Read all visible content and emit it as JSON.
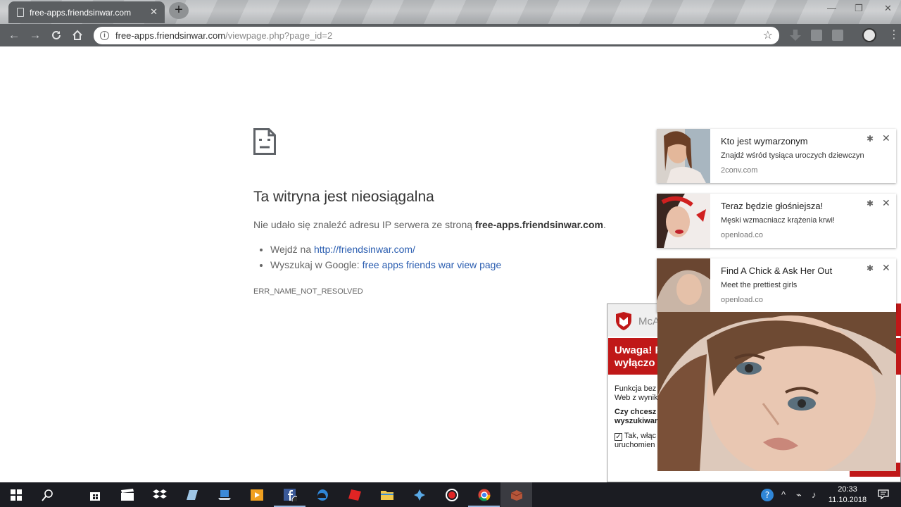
{
  "browser": {
    "tab_title": "free-apps.friendsinwar.com",
    "tab_close": "✕",
    "new_tab": "+",
    "url_host": "free-apps.friendsinwar.com",
    "url_path": "/viewpage.php?page_id=2",
    "win_min": "—",
    "win_max": "❐",
    "win_close": "✕"
  },
  "error_page": {
    "title": "Ta witryna jest nieosiągalna",
    "desc_prefix": "Nie udało się znaleźć adresu IP serwera ze stroną ",
    "desc_host": "free-apps.friendsinwar.com",
    "desc_suffix": ".",
    "suggestion1_prefix": "Wejdź na ",
    "suggestion1_link": "http://friendsinwar.com/",
    "suggestion2_prefix": "Wyszukaj w Google: ",
    "suggestion2_link": "free apps friends war view page",
    "code": "ERR_NAME_NOT_RESOLVED"
  },
  "notifications": [
    {
      "title": "Kto jest wymarzonym",
      "body": "Znajdź wśród tysiąca uroczych dziewczyn",
      "source": "2conv.com"
    },
    {
      "title": "Teraz będzie głośniejsza!",
      "body": "Męski wzmacniacz krążenia krwi!",
      "source": "openload.co"
    },
    {
      "title": "Find A Chick & Ask Her Out",
      "body": "Meet the prettiest girls",
      "source": "openload.co"
    }
  ],
  "mcafee": {
    "brand": "McA",
    "banner_line1": "Uwaga! F",
    "banner_line2": "wyłączo",
    "body_line1": "Funkcja bez",
    "body_line2": "Web z wynik",
    "question_line1": "Czy chcesz",
    "question_line2": "wyszukiwar",
    "check_line1": "Tak, włąc",
    "check_line2": "uruchomien"
  },
  "taskbar": {
    "clock_time": "20:33",
    "clock_date": "11.10.2018"
  },
  "colors": {
    "chrome_dark": "#5b5e61",
    "link_blue": "#2a5db0",
    "mcafee_red": "#c01818",
    "taskbar": "#1b1c22"
  }
}
